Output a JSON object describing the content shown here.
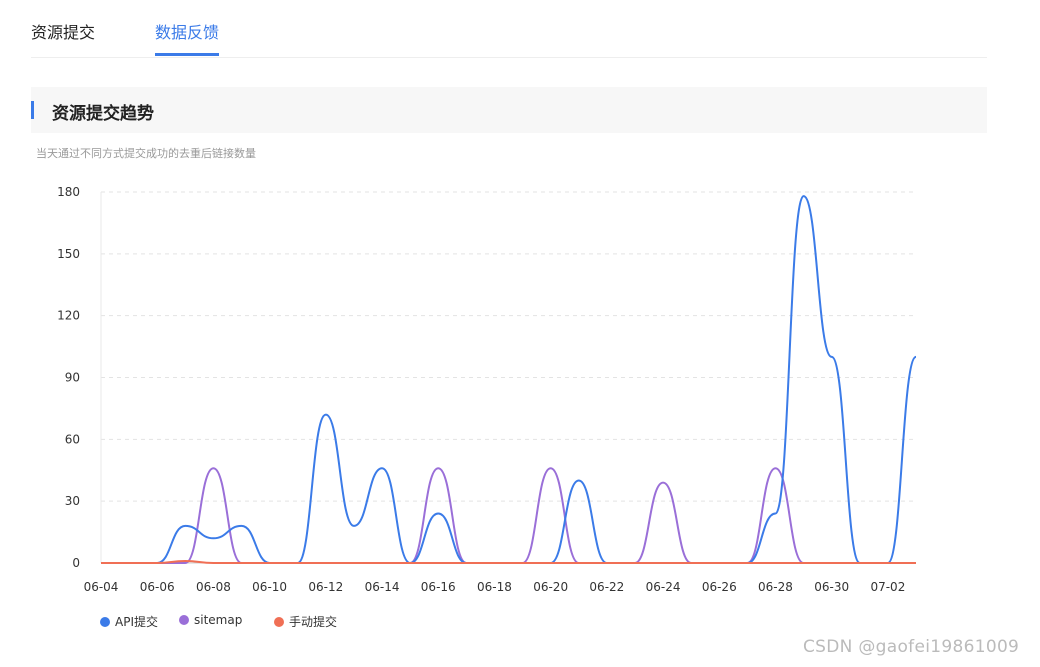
{
  "tabs": [
    {
      "label": "资源提交",
      "active": false
    },
    {
      "label": "数据反馈",
      "active": true
    }
  ],
  "section": {
    "title": "资源提交趋势",
    "subtitle": "当天通过不同方式提交成功的去重后链接数量"
  },
  "colors": {
    "accent": "#3b7be8"
  },
  "watermark": "CSDN @gaofei19861009",
  "chart_data": {
    "type": "line",
    "x": [
      "06-04",
      "06-05",
      "06-06",
      "06-07",
      "06-08",
      "06-09",
      "06-10",
      "06-11",
      "06-12",
      "06-13",
      "06-14",
      "06-15",
      "06-16",
      "06-17",
      "06-18",
      "06-19",
      "06-20",
      "06-21",
      "06-22",
      "06-23",
      "06-24",
      "06-25",
      "06-26",
      "06-27",
      "06-28",
      "06-29",
      "06-30",
      "07-01",
      "07-02",
      "07-03"
    ],
    "x_tick_labels": [
      "06-04",
      "06-06",
      "06-08",
      "06-10",
      "06-12",
      "06-14",
      "06-16",
      "06-18",
      "06-20",
      "06-22",
      "06-24",
      "06-26",
      "06-28",
      "06-30",
      "07-02"
    ],
    "y_ticks": [
      0,
      30,
      60,
      90,
      120,
      150,
      180
    ],
    "ylim": [
      0,
      180
    ],
    "grid": true,
    "legend_position": "bottom-left",
    "smooth": true,
    "series": [
      {
        "name": "API提交",
        "color": "#3b7be8",
        "values": [
          0,
          0,
          0,
          18,
          12,
          18,
          0,
          0,
          72,
          18,
          46,
          0,
          24,
          0,
          0,
          0,
          0,
          40,
          0,
          0,
          0,
          0,
          0,
          0,
          24,
          178,
          100,
          0,
          0,
          100
        ]
      },
      {
        "name": "sitemap",
        "color": "#9a6fd8",
        "values": [
          0,
          0,
          0,
          0,
          46,
          0,
          0,
          0,
          0,
          0,
          0,
          0,
          46,
          0,
          0,
          0,
          46,
          0,
          0,
          0,
          39,
          0,
          0,
          0,
          46,
          0,
          0,
          0,
          0,
          0
        ]
      },
      {
        "name": "手动提交",
        "color": "#f06f55",
        "values": [
          0,
          0,
          0,
          1,
          0,
          0,
          0,
          0,
          0,
          0,
          0,
          0,
          0,
          0,
          0,
          0,
          0,
          0,
          0,
          0,
          0,
          0,
          0,
          0,
          0,
          0,
          0,
          0,
          0,
          0
        ]
      }
    ]
  }
}
